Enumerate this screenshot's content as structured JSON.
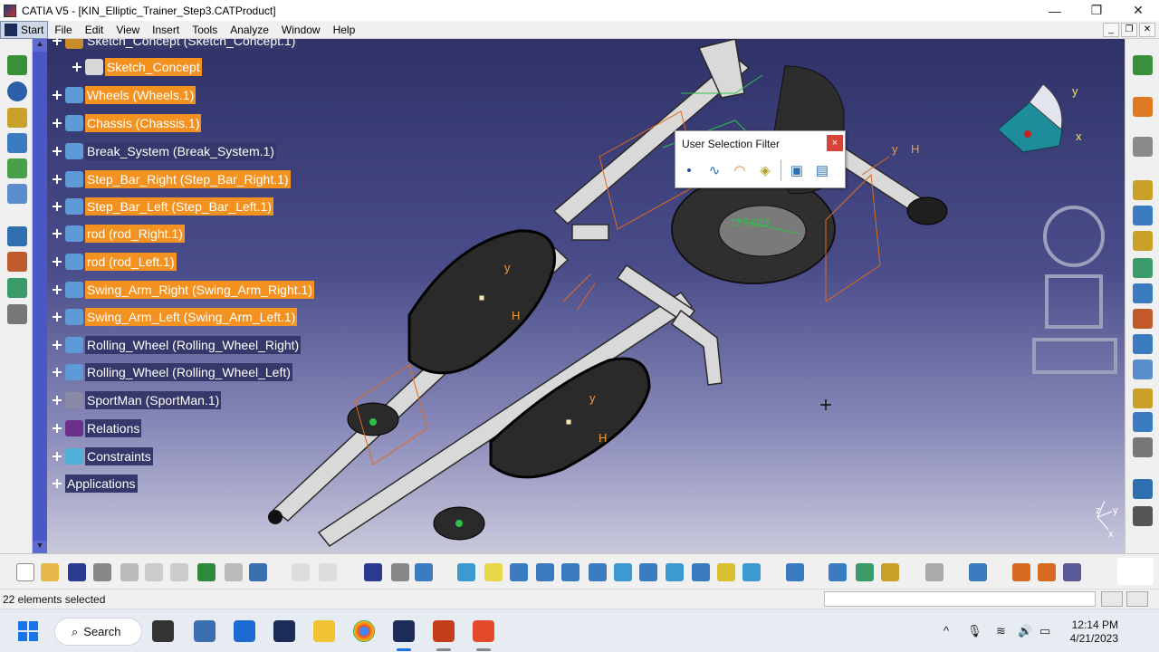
{
  "window": {
    "title": "CATIA V5 - [KIN_Elliptic_Trainer_Step3.CATProduct]",
    "controls": [
      "—",
      "❐",
      "✕"
    ]
  },
  "menu": {
    "start": "Start",
    "items": [
      "File",
      "Edit",
      "View",
      "Insert",
      "Tools",
      "Analyze",
      "Window",
      "Help"
    ],
    "mdi": [
      "_",
      "❐",
      "✕"
    ]
  },
  "tree": {
    "items": [
      {
        "label": "Sketch_Concept (Sketch_Concept.1)",
        "selected": false,
        "partial": true
      },
      {
        "label": "Sketch_Concept",
        "selected": true
      },
      {
        "label": "Wheels (Wheels.1)",
        "selected": true
      },
      {
        "label": "Chassis (Chassis.1)",
        "selected": true
      },
      {
        "label": "Break_System (Break_System.1)",
        "selected": false
      },
      {
        "label": "Step_Bar_Right (Step_Bar_Right.1)",
        "selected": true
      },
      {
        "label": "Step_Bar_Left (Step_Bar_Left.1)",
        "selected": true
      },
      {
        "label": "rod (rod_Right.1)",
        "selected": true
      },
      {
        "label": "rod (rod_Left.1)",
        "selected": true
      },
      {
        "label": "Swing_Arm_Right (Swing_Arm_Right.1)",
        "selected": true
      },
      {
        "label": "Swing_Arm_Left (Swing_Arm_Left.1)",
        "selected": true
      },
      {
        "label": "Rolling_Wheel (Rolling_Wheel_Right)",
        "selected": false
      },
      {
        "label": "Rolling_Wheel (Rolling_Wheel_Left)",
        "selected": false
      },
      {
        "label": "SportMan (SportMan.1)",
        "selected": false
      },
      {
        "label": "Relations",
        "selected": false
      },
      {
        "label": "Constraints",
        "selected": false
      },
      {
        "label": "Applications",
        "selected": false
      }
    ]
  },
  "selection_filter": {
    "title": "User Selection Filter",
    "close": "×"
  },
  "viewport": {
    "dimension_label": "177.023",
    "compass_axes": [
      "y",
      "x"
    ],
    "axis_labels": [
      "y",
      "H",
      "y",
      "H",
      "y",
      "H"
    ],
    "triad": [
      "z",
      "y",
      "x"
    ]
  },
  "status": {
    "message": "22 elements selected"
  },
  "taskbar": {
    "search": "Search",
    "time": "12:14 PM",
    "date": "4/21/2023"
  },
  "colors": {
    "selection": "#f39221",
    "tree_bg": "#34386a",
    "scrollbar": "#4b57c6"
  }
}
